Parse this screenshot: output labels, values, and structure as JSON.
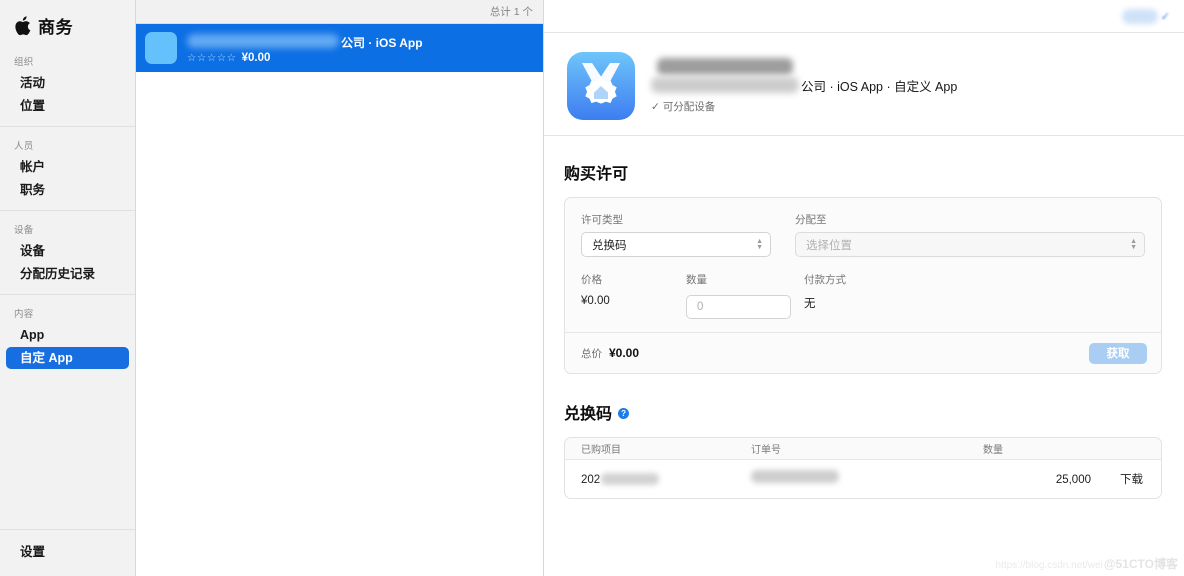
{
  "sidebar": {
    "brand_title": "商务",
    "groups": [
      {
        "label": "组织",
        "items": [
          {
            "label": "活动",
            "selected": false
          },
          {
            "label": "位置",
            "selected": false
          }
        ]
      },
      {
        "label": "人员",
        "items": [
          {
            "label": "帐户",
            "selected": false
          },
          {
            "label": "职务",
            "selected": false
          }
        ]
      },
      {
        "label": "设备",
        "items": [
          {
            "label": "设备",
            "selected": false
          },
          {
            "label": "分配历史记录",
            "selected": false
          }
        ]
      },
      {
        "label": "内容",
        "items": [
          {
            "label": "App",
            "selected": false
          },
          {
            "label": "自定 App",
            "selected": true
          }
        ]
      }
    ],
    "footer_item": "设置"
  },
  "list": {
    "count_label": "总计 1 个",
    "row": {
      "vendor_line": "公司 · iOS App",
      "stars": "☆☆☆☆☆",
      "price": "¥0.00"
    }
  },
  "detail": {
    "app": {
      "vendor_line": "公司 · iOS App · 自定义 App",
      "assignable_label": "可分配设备",
      "assignable_tick": "✓"
    },
    "purchase": {
      "title": "购买许可",
      "license_type_label": "许可类型",
      "license_type_value": "兑换码",
      "assign_to_label": "分配至",
      "assign_to_placeholder": "选择位置",
      "price_label": "价格",
      "price_value": "¥0.00",
      "quantity_label": "数量",
      "quantity_placeholder": "0",
      "payment_label": "付款方式",
      "payment_value": "无",
      "total_label": "总价",
      "total_value": "¥0.00",
      "get_button": "获取"
    },
    "codes": {
      "title": "兑换码",
      "help_glyph": "?",
      "columns": [
        "已购项目",
        "订单号",
        "数量"
      ],
      "rows": [
        {
          "item_prefix": "202",
          "order": "",
          "quantity": "25,000",
          "action": "下载"
        }
      ]
    }
  },
  "watermark": {
    "url": "https://blog.csdn.net/wei",
    "tag": "@51CTO博客"
  },
  "colors": {
    "accent_blue": "#0d6fe4",
    "sidebar_bg": "#f2f2f2",
    "selected_nav": "#176ee0",
    "disabled_button": "#a9cdf3"
  }
}
